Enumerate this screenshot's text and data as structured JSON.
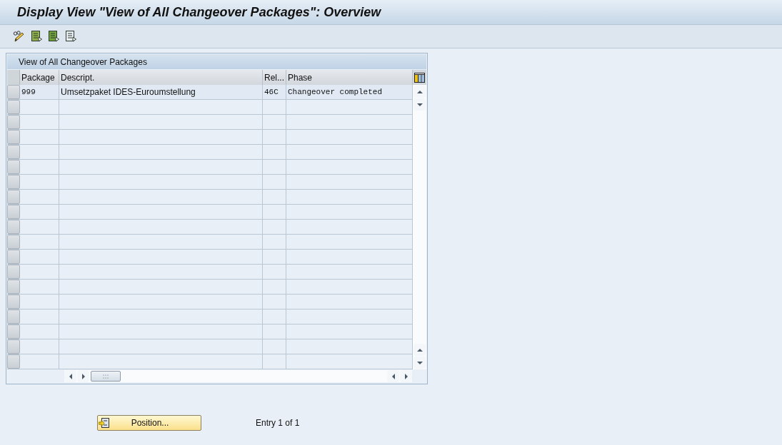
{
  "window": {
    "title": "Display View \"View of All Changeover Packages\": Overview"
  },
  "table": {
    "title": "View of All Changeover Packages",
    "columns": [
      {
        "label": "Package",
        "kind": "code"
      },
      {
        "label": "Descript.",
        "kind": "text"
      },
      {
        "label": "Rel...",
        "kind": "code"
      },
      {
        "label": "Phase",
        "kind": "code"
      }
    ],
    "rows": [
      {
        "cells": [
          "999",
          "Umsetzpaket IDES-Euroumstellung",
          "46C",
          "Changeover completed"
        ]
      }
    ]
  },
  "footer": {
    "button": "Position...",
    "entry_info": "Entry 1 of 1"
  }
}
